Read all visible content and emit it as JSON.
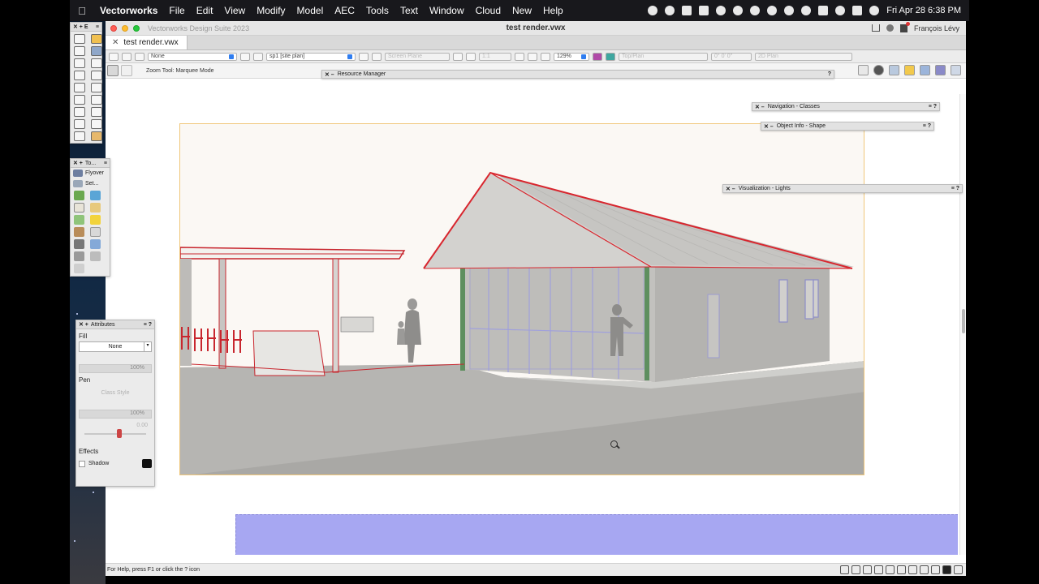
{
  "menubar": {
    "app_name": "Vectorworks",
    "items": [
      "File",
      "Edit",
      "View",
      "Modify",
      "Model",
      "AEC",
      "Tools",
      "Text",
      "Window",
      "Cloud",
      "New",
      "Help"
    ],
    "clock": "Fri Apr 28  6:38 PM"
  },
  "window": {
    "suite_label": "Vectorworks Design Suite 2023",
    "doc_title": "test render.vwx",
    "user_name": "François Lévy"
  },
  "tab": {
    "label": "test render.vwx"
  },
  "viewbar": {
    "class_value": "None",
    "layer_value": "sp1 [site plan]",
    "plane_value": "Screen Plane",
    "scale_value": "1:1",
    "zoom_value": "129%",
    "view_value": "Top/Plan",
    "rotation_value": "0° 0' 0\"",
    "render_value": "2D Plan"
  },
  "toolbar": {
    "mode_hint": "Zoom Tool: Marquee Mode"
  },
  "palettes": {
    "resource_manager": "Resource Manager",
    "navigation": "Navigation - Classes",
    "object_info": "Object Info - Shape",
    "visualization": "Visualization - Lights",
    "tool_sets_title": "To...",
    "flyover": "Flyover",
    "set_label": "Set..."
  },
  "attributes": {
    "title": "Attributes",
    "fill_label": "Fill",
    "fill_value": "None",
    "fill_opacity": "100%",
    "pen_label": "Pen",
    "pen_value": "Class Style",
    "pen_opacity": "100%",
    "pen_thickness": "0.00",
    "effects_label": "Effects",
    "shadow_label": "Shadow"
  },
  "statusbar": {
    "help_text": "For Help, press F1 or click the ? icon"
  },
  "colors": {
    "accent_blue": "#2f7df0",
    "roof_red": "#d8262e",
    "wall_gray": "#aaa9a6",
    "render_frame": "#f0c77a",
    "lavender_layer": "#a7a7f2"
  }
}
